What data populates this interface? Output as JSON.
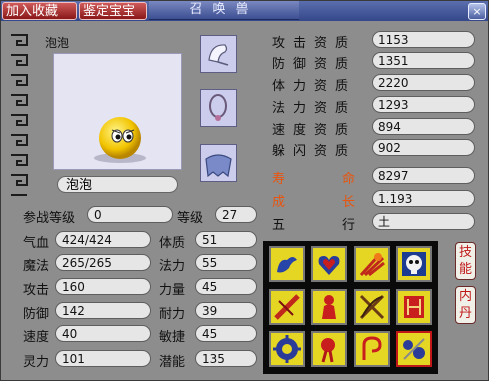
{
  "window": {
    "title": "召唤兽",
    "buttons": {
      "favorite": "加入收藏",
      "appraise": "鉴定宝宝",
      "close": "×"
    }
  },
  "pet": {
    "header_name": "泡泡",
    "name_value": "泡泡",
    "equipment_slots": [
      {
        "name": "helmet-icon"
      },
      {
        "name": "necklace-icon"
      },
      {
        "name": "armor-icon"
      }
    ]
  },
  "aptitudes": [
    {
      "label": "攻击资质",
      "value": "1153"
    },
    {
      "label": "防御资质",
      "value": "1351"
    },
    {
      "label": "体力资质",
      "value": "2220"
    },
    {
      "label": "法力资质",
      "value": "1293"
    },
    {
      "label": "速度资质",
      "value": "894"
    },
    {
      "label": "躲闪资质",
      "value": "902"
    }
  ],
  "special": [
    {
      "label_a": "寿",
      "label_b": "命",
      "value": "8297",
      "color": "#e8550f"
    },
    {
      "label_a": "成",
      "label_b": "长",
      "value": "1.193",
      "color": "#e8550f"
    },
    {
      "label_a": "五",
      "label_b": "行",
      "value": "土",
      "color": "#111111"
    }
  ],
  "battle_level": {
    "label": "参战等级",
    "value": "0"
  },
  "level": {
    "label": "等级",
    "value": "27"
  },
  "stats_left": [
    {
      "label": "气血",
      "value": "424/424"
    },
    {
      "label": "魔法",
      "value": "265/265"
    },
    {
      "label": "攻击",
      "value": "160"
    },
    {
      "label": "防御",
      "value": "142"
    },
    {
      "label": "速度",
      "value": "40"
    },
    {
      "label": "灵力",
      "value": "101"
    }
  ],
  "stats_right": [
    {
      "label": "体质",
      "value": "51"
    },
    {
      "label": "法力",
      "value": "55"
    },
    {
      "label": "力量",
      "value": "45"
    },
    {
      "label": "耐力",
      "value": "39"
    },
    {
      "label": "敏捷",
      "value": "45"
    },
    {
      "label": "潜能",
      "value": "135"
    }
  ],
  "skills": [
    {
      "name": "strength-arm-icon"
    },
    {
      "name": "heart-shield-icon"
    },
    {
      "name": "fire-claw-icon"
    },
    {
      "name": "ghost-skull-icon"
    },
    {
      "name": "sword-slash-icon"
    },
    {
      "name": "lava-figure-icon"
    },
    {
      "name": "crossed-blades-icon"
    },
    {
      "name": "red-strike-icon"
    },
    {
      "name": "gear-orb-icon"
    },
    {
      "name": "magic-hand-icon"
    },
    {
      "name": "recall-arrow-icon"
    },
    {
      "name": "crystal-stones-icon"
    }
  ],
  "side_buttons": {
    "skills": "技能",
    "inner": "内丹"
  }
}
